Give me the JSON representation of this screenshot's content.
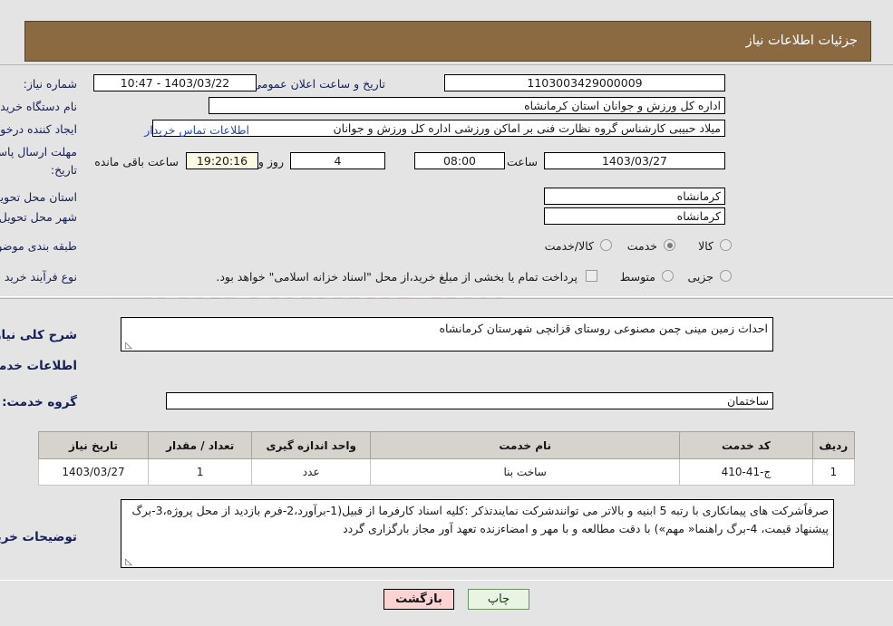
{
  "header": {
    "title": "جزئیات اطلاعات نیاز"
  },
  "watermark": {
    "text": "AnaTender.net",
    "letter": "W"
  },
  "info": {
    "need_number_label": "شماره نیاز:",
    "need_number_value": "1103003429000009",
    "announce_datetime_label": "تاریخ و ساعت اعلان عمومی:",
    "announce_datetime_value": "1403/03/22 - 10:47",
    "buyer_org_label": "نام دستگاه خریدار:",
    "buyer_org_value": "اداره کل ورزش و جوانان استان کرمانشاه",
    "creator_label": "ایجاد کننده درخواست:",
    "creator_value": "میلاد حبیبی کارشناس گروه نظارت فنی بر اماکن ورزشی اداره کل ورزش و جوانان",
    "buyer_contact_link": "اطلاعات تماس خریدار",
    "deadline_label_line1": "مهلت ارسال پاسخ: تا",
    "deadline_label_line2": "تاریخ:",
    "deadline_date": "1403/03/27",
    "hour_label": "ساعت",
    "deadline_time": "08:00",
    "days_value": "4",
    "days_label": "روز و",
    "countdown_value": "19:20:16",
    "remaining_label": "ساعت باقی مانده",
    "province_label": "استان محل تحویل:",
    "province_value": "کرمانشاه",
    "city_label": "شهر محل تحویل:",
    "city_value": "کرمانشاه",
    "category_label": "طبقه بندی موضوعی:",
    "category_options": [
      "کالا",
      "خدمت",
      "کالا/خدمت"
    ],
    "category_selected_index": 1,
    "process_label": "نوع فرآیند خرید :",
    "process_options": [
      "جزیی",
      "متوسط"
    ],
    "process_selected_index": -1,
    "treasury_checkbox_checked": false,
    "treasury_note": "پرداخت تمام یا بخشی از مبلغ خرید،از محل \"اسناد خزانه اسلامی\" خواهد بود."
  },
  "need_description": {
    "label": "شرح کلی نیاز:",
    "value": "احداث زمین مینی چمن مصنوعی روستای قزانچی شهرستان کرمانشاه"
  },
  "services_section": {
    "heading": "اطلاعات خدمات مورد نیاز",
    "group_label": "گروه خدمت:",
    "group_value": "ساختمان"
  },
  "table": {
    "headers": [
      "ردیف",
      "کد خدمت",
      "نام خدمت",
      "واحد اندازه گیری",
      "تعداد / مقدار",
      "تاریخ نیاز"
    ],
    "rows": [
      {
        "row": "1",
        "code": "ج-41-410",
        "name": "ساخت بنا",
        "unit": "عدد",
        "quantity": "1",
        "need_date": "1403/03/27"
      }
    ]
  },
  "buyer_notes": {
    "label": "توضیحات خریدار:",
    "value": "صرفاًشرکت های پیمانکاری با رتبه 5 ابنیه و بالاتر می توانندشرکت نمایندتذکر :کلیه اسناد کارفرما از قبیل(1-برآورد،2-فرم بازدید از محل پروژه،3-برگ پیشنهاد قیمت، 4-برگ راهنما« مهم») با دقت مطالعه و با مهر و امضاءزنده تعهد آور مجاز بارگزاری گردد"
  },
  "buttons": {
    "print": "چاپ",
    "back": "بازگشت"
  }
}
